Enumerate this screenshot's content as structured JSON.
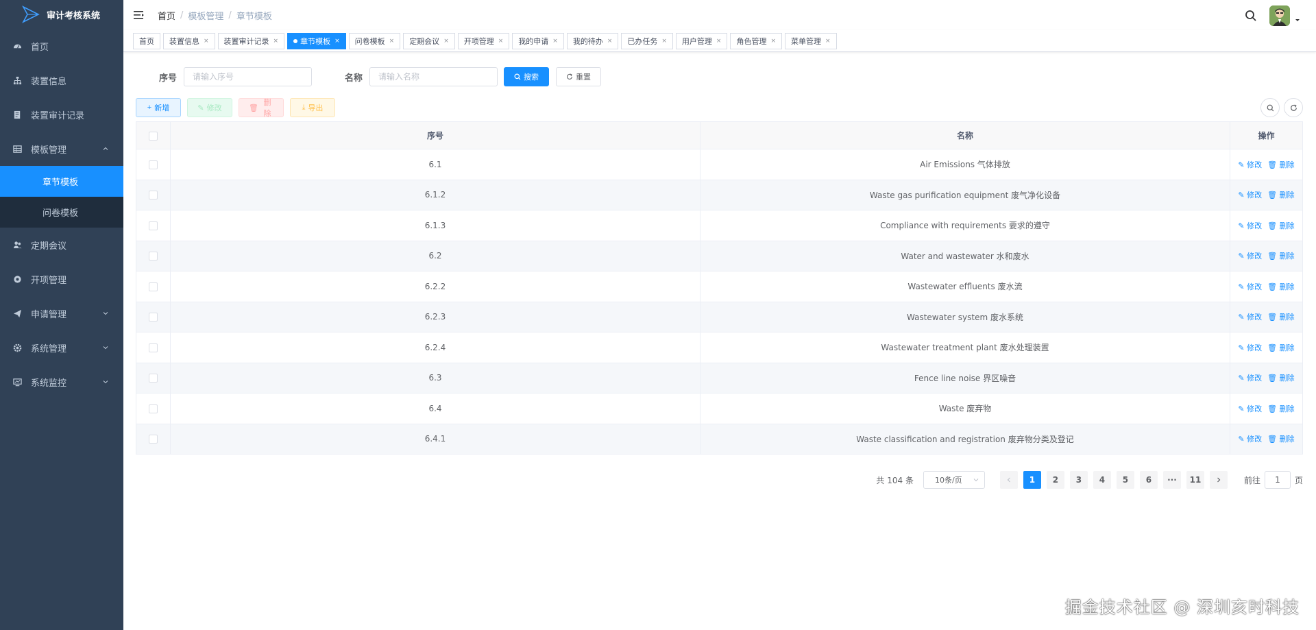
{
  "app": {
    "title": "审计考核系统"
  },
  "sidebar": {
    "items": [
      {
        "label": "首页",
        "icon": "dashboard-icon"
      },
      {
        "label": "装置信息",
        "icon": "tree-icon"
      },
      {
        "label": "装置审计记录",
        "icon": "documentation-icon"
      },
      {
        "label": "模板管理",
        "icon": "table-icon",
        "expanded": true,
        "children": [
          {
            "label": "章节模板",
            "active": true
          },
          {
            "label": "问卷模板"
          }
        ]
      },
      {
        "label": "定期会议",
        "icon": "peoples-icon"
      },
      {
        "label": "开项管理",
        "icon": "circle-icon"
      },
      {
        "label": "申请管理",
        "icon": "send-icon"
      },
      {
        "label": "系统管理",
        "icon": "system-icon"
      },
      {
        "label": "系统监控",
        "icon": "monitor-icon"
      }
    ]
  },
  "breadcrumb": [
    "首页",
    "模板管理",
    "章节模板"
  ],
  "tags": [
    {
      "label": "首页",
      "closable": false
    },
    {
      "label": "装置信息",
      "closable": true
    },
    {
      "label": "装置审计记录",
      "closable": true
    },
    {
      "label": "章节模板",
      "closable": true,
      "active": true
    },
    {
      "label": "问卷模板",
      "closable": true
    },
    {
      "label": "定期会议",
      "closable": true
    },
    {
      "label": "开项管理",
      "closable": true
    },
    {
      "label": "我的申请",
      "closable": true
    },
    {
      "label": "我的待办",
      "closable": true
    },
    {
      "label": "已办任务",
      "closable": true
    },
    {
      "label": "用户管理",
      "closable": true
    },
    {
      "label": "角色管理",
      "closable": true
    },
    {
      "label": "菜单管理",
      "closable": true
    }
  ],
  "search": {
    "seq_label": "序号",
    "seq_placeholder": "请输入序号",
    "name_label": "名称",
    "name_placeholder": "请输入名称",
    "search_btn": "搜索",
    "reset_btn": "重置"
  },
  "toolbar": {
    "add": "新增",
    "edit": "修改",
    "delete": "删除",
    "export": "导出"
  },
  "table": {
    "headers": [
      "序号",
      "名称",
      "操作"
    ],
    "op_edit": "修改",
    "op_delete": "删除",
    "rows": [
      {
        "seq": "6.1",
        "name": "Air Emissions 气体排放"
      },
      {
        "seq": "6.1.2",
        "name": "Waste gas purification equipment 废气净化设备"
      },
      {
        "seq": "6.1.3",
        "name": "Compliance with requirements 要求的遵守"
      },
      {
        "seq": "6.2",
        "name": "Water and wastewater 水和废水"
      },
      {
        "seq": "6.2.2",
        "name": "Wastewater effluents 废水流"
      },
      {
        "seq": "6.2.3",
        "name": "Wastewater system 废水系统"
      },
      {
        "seq": "6.2.4",
        "name": "Wastewater treatment plant 废水处理装置"
      },
      {
        "seq": "6.3",
        "name": "Fence line noise 界区噪音"
      },
      {
        "seq": "6.4",
        "name": "Waste 废弃物"
      },
      {
        "seq": "6.4.1",
        "name": "Waste classification and registration 废弃物分类及登记"
      }
    ]
  },
  "pagination": {
    "total": "共 104 条",
    "page_size": "10条/页",
    "pages": [
      "1",
      "2",
      "3",
      "4",
      "5",
      "6",
      "···",
      "11"
    ],
    "current": "1",
    "goto_prefix": "前往",
    "goto_value": "1",
    "goto_suffix": "页"
  },
  "watermark": "掘金技术社区 @ 深圳亥时科技",
  "colors": {
    "sidebar_bg": "#304156",
    "primary": "#1890ff"
  }
}
